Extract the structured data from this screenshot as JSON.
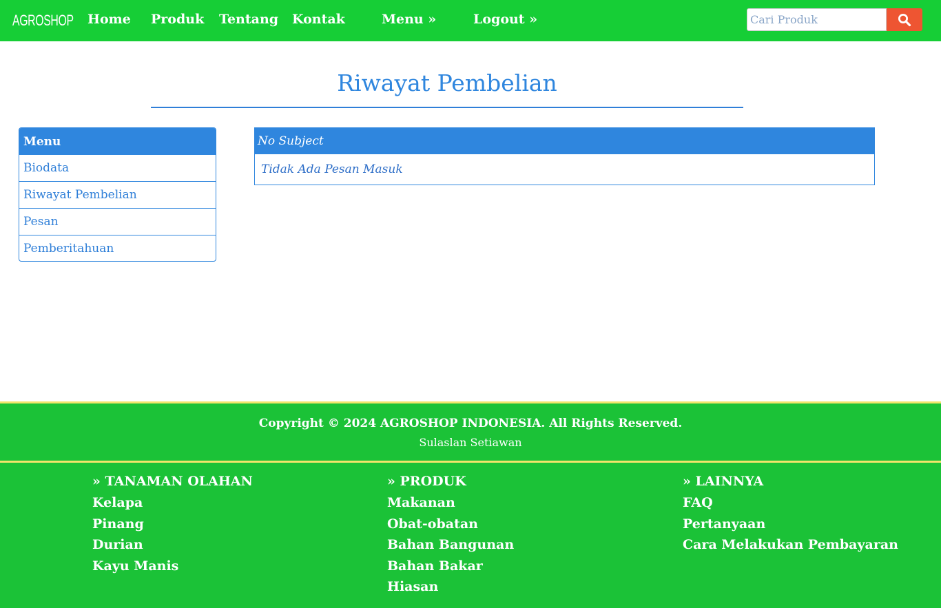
{
  "navbar": {
    "brand": "AGROSHOP",
    "links": [
      "Home",
      "Produk",
      "Tentang",
      "Kontak",
      "Menu »",
      "Logout »"
    ],
    "search_placeholder": "Cari Produk",
    "search_icon": "search-icon"
  },
  "page": {
    "title": "Riwayat Pembelian"
  },
  "sidebar": {
    "heading": "Menu",
    "items": [
      "Biodata",
      "Riwayat Pembelian",
      "Pesan",
      "Pemberitahuan"
    ]
  },
  "messages": {
    "header": "No Subject",
    "empty_text": "Tidak Ada Pesan Masuk"
  },
  "footer": {
    "copyright": "Copyright © 2024 AGROSHOP INDONESIA. All Rights Reserved.",
    "author": "Sulaslan Setiawan",
    "columns": [
      {
        "title": "» TANAMAN OLAHAN",
        "items": [
          "Kelapa",
          "Pinang",
          "Durian",
          "Kayu Manis"
        ]
      },
      {
        "title": "» PRODUK",
        "items": [
          "Makanan",
          "Obat-obatan",
          "Bahan Bangunan",
          "Bahan Bakar",
          "Hiasan"
        ]
      },
      {
        "title": "» LAINNYA",
        "items": [
          "FAQ",
          "Pertanyaan",
          "Cara Melakukan Pembayaran"
        ]
      }
    ]
  },
  "colors": {
    "nav_green": "#16ce36",
    "footer_green": "#1bc237",
    "accent_blue": "#2f86de",
    "search_button": "#ee5532",
    "footer_border": "#f2e56b"
  }
}
